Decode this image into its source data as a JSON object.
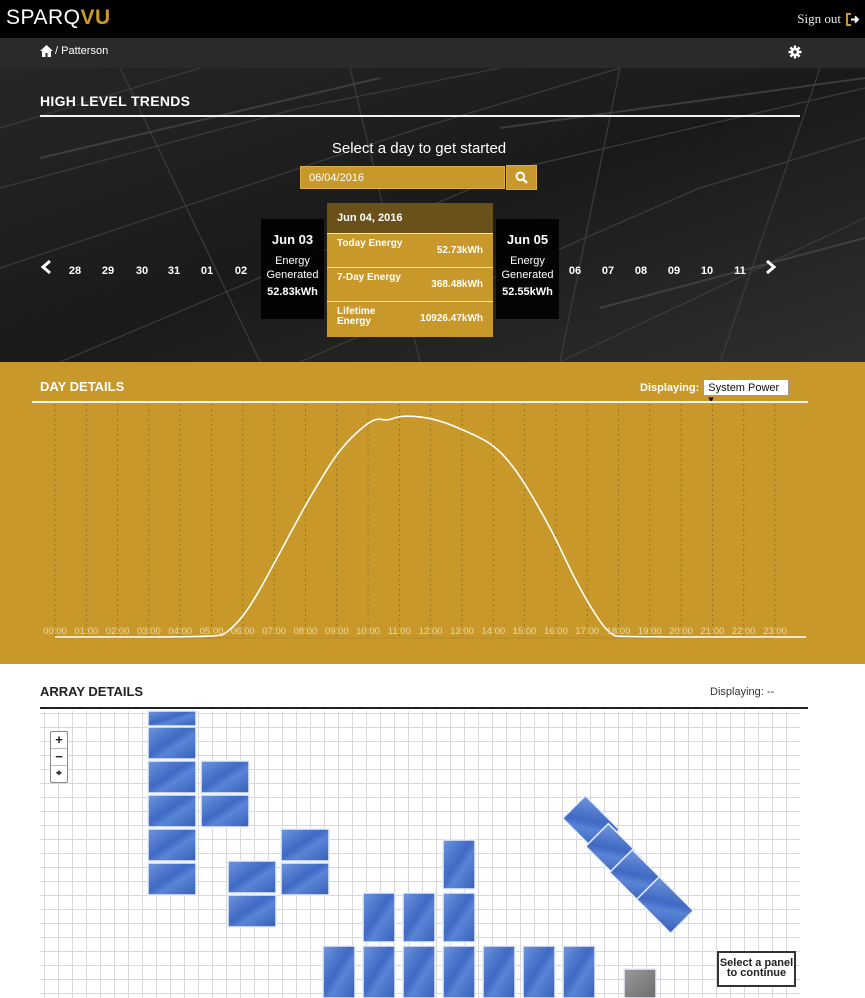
{
  "app": {
    "logo_main": "SPARQ",
    "logo_accent": "VU",
    "signout_label": "Sign out"
  },
  "breadcrumb": {
    "site": "/ Patterson"
  },
  "trends": {
    "title": "HIGH LEVEL TRENDS",
    "prompt": "Select a day to get started",
    "date_value": "06/04/2016",
    "days_before": [
      "28",
      "29",
      "30",
      "31",
      "01",
      "02"
    ],
    "days_after": [
      "06",
      "07",
      "08",
      "09",
      "10",
      "11"
    ],
    "prev_card": {
      "date": "Jun 03",
      "label": "Energy Generated",
      "value": "52.83kWh"
    },
    "next_card": {
      "date": "Jun 05",
      "label": "Energy Generated",
      "value": "52.55kWh"
    },
    "selected_card": {
      "date": "Jun 04, 2016",
      "rows": [
        {
          "label": "Today Energy",
          "value": "52.73kWh"
        },
        {
          "label": "7-Day Energy",
          "value": "368.48kWh"
        },
        {
          "label": "Lifetime Energy",
          "value": "10926.47kWh"
        }
      ]
    }
  },
  "day_details": {
    "title": "DAY DETAILS",
    "displaying_label": "Displaying:",
    "displaying_value": "System Power"
  },
  "chart_data": {
    "type": "line",
    "title": "",
    "xlabel": "",
    "ylabel": "",
    "grid": true,
    "x_ticks": [
      "00:00",
      "01:00",
      "02:00",
      "03:00",
      "04:00",
      "05:00",
      "06:00",
      "07:00",
      "08:00",
      "09:00",
      "10:00",
      "11:00",
      "12:00",
      "13:00",
      "14:00",
      "15:00",
      "16:00",
      "17:00",
      "18:00",
      "19:00",
      "20:00",
      "21:00",
      "22:00",
      "23:00"
    ],
    "ylim": [
      0,
      1
    ],
    "series": [
      {
        "x": [
          0,
          5.2,
          5.5,
          6,
          6.5,
          7,
          7.5,
          8,
          8.5,
          9,
          9.5,
          10,
          10.3,
          10.6,
          11,
          11.5,
          12,
          12.5,
          13,
          13.5,
          14,
          14.5,
          15,
          15.5,
          16,
          16.5,
          17,
          17.5,
          17.8,
          18,
          24
        ],
        "y": [
          0,
          0,
          0.02,
          0.09,
          0.2,
          0.33,
          0.46,
          0.59,
          0.71,
          0.82,
          0.9,
          0.96,
          0.98,
          0.97,
          0.99,
          0.99,
          0.98,
          0.96,
          0.93,
          0.9,
          0.86,
          0.79,
          0.69,
          0.57,
          0.44,
          0.29,
          0.16,
          0.05,
          0.01,
          0,
          0
        ]
      }
    ]
  },
  "array_details": {
    "title": "ARRAY DETAILS",
    "displaying": "Displaying: --",
    "zoom_in": "+",
    "zoom_out": "−",
    "zoom_reset": "⌖",
    "note": "Select a panel to continue"
  }
}
